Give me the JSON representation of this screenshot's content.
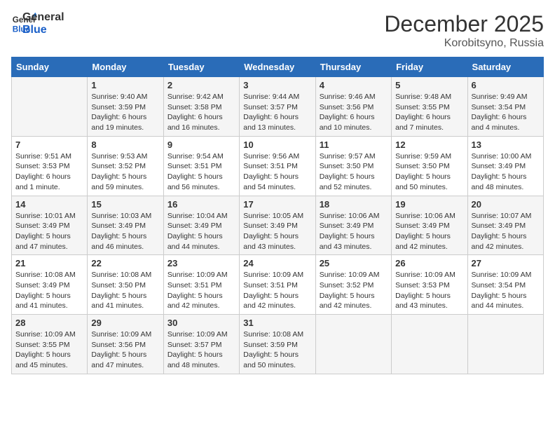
{
  "logo": {
    "line1": "General",
    "line2": "Blue"
  },
  "title": "December 2025",
  "location": "Korobitsyno, Russia",
  "days_header": [
    "Sunday",
    "Monday",
    "Tuesday",
    "Wednesday",
    "Thursday",
    "Friday",
    "Saturday"
  ],
  "weeks": [
    [
      {
        "day": "",
        "info": ""
      },
      {
        "day": "1",
        "info": "Sunrise: 9:40 AM\nSunset: 3:59 PM\nDaylight: 6 hours\nand 19 minutes."
      },
      {
        "day": "2",
        "info": "Sunrise: 9:42 AM\nSunset: 3:58 PM\nDaylight: 6 hours\nand 16 minutes."
      },
      {
        "day": "3",
        "info": "Sunrise: 9:44 AM\nSunset: 3:57 PM\nDaylight: 6 hours\nand 13 minutes."
      },
      {
        "day": "4",
        "info": "Sunrise: 9:46 AM\nSunset: 3:56 PM\nDaylight: 6 hours\nand 10 minutes."
      },
      {
        "day": "5",
        "info": "Sunrise: 9:48 AM\nSunset: 3:55 PM\nDaylight: 6 hours\nand 7 minutes."
      },
      {
        "day": "6",
        "info": "Sunrise: 9:49 AM\nSunset: 3:54 PM\nDaylight: 6 hours\nand 4 minutes."
      }
    ],
    [
      {
        "day": "7",
        "info": "Sunrise: 9:51 AM\nSunset: 3:53 PM\nDaylight: 6 hours\nand 1 minute."
      },
      {
        "day": "8",
        "info": "Sunrise: 9:53 AM\nSunset: 3:52 PM\nDaylight: 5 hours\nand 59 minutes."
      },
      {
        "day": "9",
        "info": "Sunrise: 9:54 AM\nSunset: 3:51 PM\nDaylight: 5 hours\nand 56 minutes."
      },
      {
        "day": "10",
        "info": "Sunrise: 9:56 AM\nSunset: 3:51 PM\nDaylight: 5 hours\nand 54 minutes."
      },
      {
        "day": "11",
        "info": "Sunrise: 9:57 AM\nSunset: 3:50 PM\nDaylight: 5 hours\nand 52 minutes."
      },
      {
        "day": "12",
        "info": "Sunrise: 9:59 AM\nSunset: 3:50 PM\nDaylight: 5 hours\nand 50 minutes."
      },
      {
        "day": "13",
        "info": "Sunrise: 10:00 AM\nSunset: 3:49 PM\nDaylight: 5 hours\nand 48 minutes."
      }
    ],
    [
      {
        "day": "14",
        "info": "Sunrise: 10:01 AM\nSunset: 3:49 PM\nDaylight: 5 hours\nand 47 minutes."
      },
      {
        "day": "15",
        "info": "Sunrise: 10:03 AM\nSunset: 3:49 PM\nDaylight: 5 hours\nand 46 minutes."
      },
      {
        "day": "16",
        "info": "Sunrise: 10:04 AM\nSunset: 3:49 PM\nDaylight: 5 hours\nand 44 minutes."
      },
      {
        "day": "17",
        "info": "Sunrise: 10:05 AM\nSunset: 3:49 PM\nDaylight: 5 hours\nand 43 minutes."
      },
      {
        "day": "18",
        "info": "Sunrise: 10:06 AM\nSunset: 3:49 PM\nDaylight: 5 hours\nand 43 minutes."
      },
      {
        "day": "19",
        "info": "Sunrise: 10:06 AM\nSunset: 3:49 PM\nDaylight: 5 hours\nand 42 minutes."
      },
      {
        "day": "20",
        "info": "Sunrise: 10:07 AM\nSunset: 3:49 PM\nDaylight: 5 hours\nand 42 minutes."
      }
    ],
    [
      {
        "day": "21",
        "info": "Sunrise: 10:08 AM\nSunset: 3:49 PM\nDaylight: 5 hours\nand 41 minutes."
      },
      {
        "day": "22",
        "info": "Sunrise: 10:08 AM\nSunset: 3:50 PM\nDaylight: 5 hours\nand 41 minutes."
      },
      {
        "day": "23",
        "info": "Sunrise: 10:09 AM\nSunset: 3:51 PM\nDaylight: 5 hours\nand 42 minutes."
      },
      {
        "day": "24",
        "info": "Sunrise: 10:09 AM\nSunset: 3:51 PM\nDaylight: 5 hours\nand 42 minutes."
      },
      {
        "day": "25",
        "info": "Sunrise: 10:09 AM\nSunset: 3:52 PM\nDaylight: 5 hours\nand 42 minutes."
      },
      {
        "day": "26",
        "info": "Sunrise: 10:09 AM\nSunset: 3:53 PM\nDaylight: 5 hours\nand 43 minutes."
      },
      {
        "day": "27",
        "info": "Sunrise: 10:09 AM\nSunset: 3:54 PM\nDaylight: 5 hours\nand 44 minutes."
      }
    ],
    [
      {
        "day": "28",
        "info": "Sunrise: 10:09 AM\nSunset: 3:55 PM\nDaylight: 5 hours\nand 45 minutes."
      },
      {
        "day": "29",
        "info": "Sunrise: 10:09 AM\nSunset: 3:56 PM\nDaylight: 5 hours\nand 47 minutes."
      },
      {
        "day": "30",
        "info": "Sunrise: 10:09 AM\nSunset: 3:57 PM\nDaylight: 5 hours\nand 48 minutes."
      },
      {
        "day": "31",
        "info": "Sunrise: 10:08 AM\nSunset: 3:59 PM\nDaylight: 5 hours\nand 50 minutes."
      },
      {
        "day": "",
        "info": ""
      },
      {
        "day": "",
        "info": ""
      },
      {
        "day": "",
        "info": ""
      }
    ]
  ]
}
